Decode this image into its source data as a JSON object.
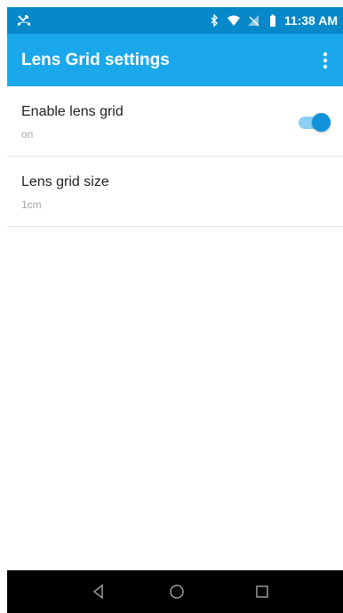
{
  "status_bar": {
    "time": "11:38 AM",
    "icons": [
      "missed-call-icon",
      "bluetooth-icon",
      "wifi-icon",
      "no-sim-icon",
      "battery-icon"
    ]
  },
  "app_bar": {
    "title": "Lens Grid settings",
    "menu_icon": "overflow-menu-icon"
  },
  "settings": [
    {
      "title": "Enable lens grid",
      "summary": "on",
      "toggle": true
    },
    {
      "title": "Lens grid size",
      "summary": "1cm"
    }
  ],
  "nav_bar": {
    "icons": [
      "back-icon",
      "home-icon",
      "recents-icon"
    ]
  },
  "colors": {
    "status_bar": "#0788c8",
    "app_bar": "#1ba8ea",
    "accent": "#1193dc",
    "nav_bar": "#000000"
  }
}
